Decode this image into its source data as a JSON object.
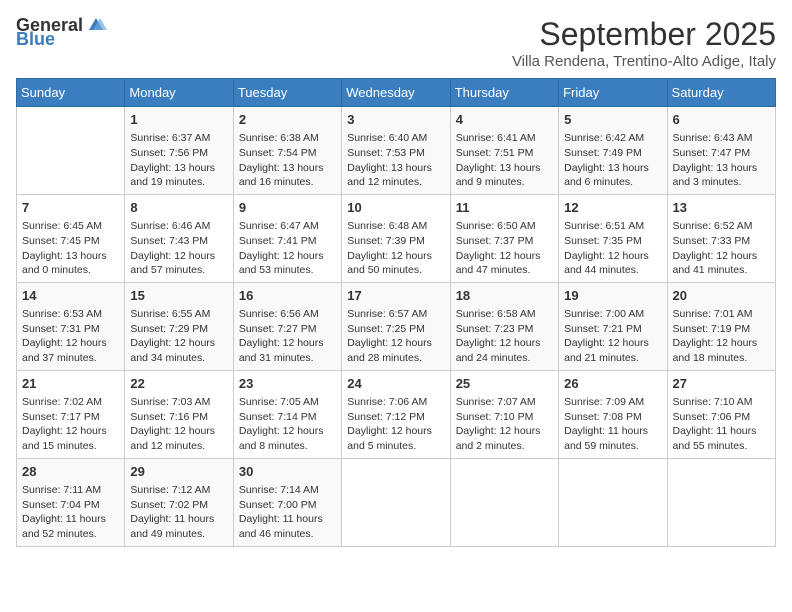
{
  "header": {
    "logo_general": "General",
    "logo_blue": "Blue",
    "month": "September 2025",
    "location": "Villa Rendena, Trentino-Alto Adige, Italy"
  },
  "days_of_week": [
    "Sunday",
    "Monday",
    "Tuesday",
    "Wednesday",
    "Thursday",
    "Friday",
    "Saturday"
  ],
  "weeks": [
    [
      {
        "day": "",
        "info": ""
      },
      {
        "day": "1",
        "info": "Sunrise: 6:37 AM\nSunset: 7:56 PM\nDaylight: 13 hours and 19 minutes."
      },
      {
        "day": "2",
        "info": "Sunrise: 6:38 AM\nSunset: 7:54 PM\nDaylight: 13 hours and 16 minutes."
      },
      {
        "day": "3",
        "info": "Sunrise: 6:40 AM\nSunset: 7:53 PM\nDaylight: 13 hours and 12 minutes."
      },
      {
        "day": "4",
        "info": "Sunrise: 6:41 AM\nSunset: 7:51 PM\nDaylight: 13 hours and 9 minutes."
      },
      {
        "day": "5",
        "info": "Sunrise: 6:42 AM\nSunset: 7:49 PM\nDaylight: 13 hours and 6 minutes."
      },
      {
        "day": "6",
        "info": "Sunrise: 6:43 AM\nSunset: 7:47 PM\nDaylight: 13 hours and 3 minutes."
      }
    ],
    [
      {
        "day": "7",
        "info": "Sunrise: 6:45 AM\nSunset: 7:45 PM\nDaylight: 13 hours and 0 minutes."
      },
      {
        "day": "8",
        "info": "Sunrise: 6:46 AM\nSunset: 7:43 PM\nDaylight: 12 hours and 57 minutes."
      },
      {
        "day": "9",
        "info": "Sunrise: 6:47 AM\nSunset: 7:41 PM\nDaylight: 12 hours and 53 minutes."
      },
      {
        "day": "10",
        "info": "Sunrise: 6:48 AM\nSunset: 7:39 PM\nDaylight: 12 hours and 50 minutes."
      },
      {
        "day": "11",
        "info": "Sunrise: 6:50 AM\nSunset: 7:37 PM\nDaylight: 12 hours and 47 minutes."
      },
      {
        "day": "12",
        "info": "Sunrise: 6:51 AM\nSunset: 7:35 PM\nDaylight: 12 hours and 44 minutes."
      },
      {
        "day": "13",
        "info": "Sunrise: 6:52 AM\nSunset: 7:33 PM\nDaylight: 12 hours and 41 minutes."
      }
    ],
    [
      {
        "day": "14",
        "info": "Sunrise: 6:53 AM\nSunset: 7:31 PM\nDaylight: 12 hours and 37 minutes."
      },
      {
        "day": "15",
        "info": "Sunrise: 6:55 AM\nSunset: 7:29 PM\nDaylight: 12 hours and 34 minutes."
      },
      {
        "day": "16",
        "info": "Sunrise: 6:56 AM\nSunset: 7:27 PM\nDaylight: 12 hours and 31 minutes."
      },
      {
        "day": "17",
        "info": "Sunrise: 6:57 AM\nSunset: 7:25 PM\nDaylight: 12 hours and 28 minutes."
      },
      {
        "day": "18",
        "info": "Sunrise: 6:58 AM\nSunset: 7:23 PM\nDaylight: 12 hours and 24 minutes."
      },
      {
        "day": "19",
        "info": "Sunrise: 7:00 AM\nSunset: 7:21 PM\nDaylight: 12 hours and 21 minutes."
      },
      {
        "day": "20",
        "info": "Sunrise: 7:01 AM\nSunset: 7:19 PM\nDaylight: 12 hours and 18 minutes."
      }
    ],
    [
      {
        "day": "21",
        "info": "Sunrise: 7:02 AM\nSunset: 7:17 PM\nDaylight: 12 hours and 15 minutes."
      },
      {
        "day": "22",
        "info": "Sunrise: 7:03 AM\nSunset: 7:16 PM\nDaylight: 12 hours and 12 minutes."
      },
      {
        "day": "23",
        "info": "Sunrise: 7:05 AM\nSunset: 7:14 PM\nDaylight: 12 hours and 8 minutes."
      },
      {
        "day": "24",
        "info": "Sunrise: 7:06 AM\nSunset: 7:12 PM\nDaylight: 12 hours and 5 minutes."
      },
      {
        "day": "25",
        "info": "Sunrise: 7:07 AM\nSunset: 7:10 PM\nDaylight: 12 hours and 2 minutes."
      },
      {
        "day": "26",
        "info": "Sunrise: 7:09 AM\nSunset: 7:08 PM\nDaylight: 11 hours and 59 minutes."
      },
      {
        "day": "27",
        "info": "Sunrise: 7:10 AM\nSunset: 7:06 PM\nDaylight: 11 hours and 55 minutes."
      }
    ],
    [
      {
        "day": "28",
        "info": "Sunrise: 7:11 AM\nSunset: 7:04 PM\nDaylight: 11 hours and 52 minutes."
      },
      {
        "day": "29",
        "info": "Sunrise: 7:12 AM\nSunset: 7:02 PM\nDaylight: 11 hours and 49 minutes."
      },
      {
        "day": "30",
        "info": "Sunrise: 7:14 AM\nSunset: 7:00 PM\nDaylight: 11 hours and 46 minutes."
      },
      {
        "day": "",
        "info": ""
      },
      {
        "day": "",
        "info": ""
      },
      {
        "day": "",
        "info": ""
      },
      {
        "day": "",
        "info": ""
      }
    ]
  ]
}
